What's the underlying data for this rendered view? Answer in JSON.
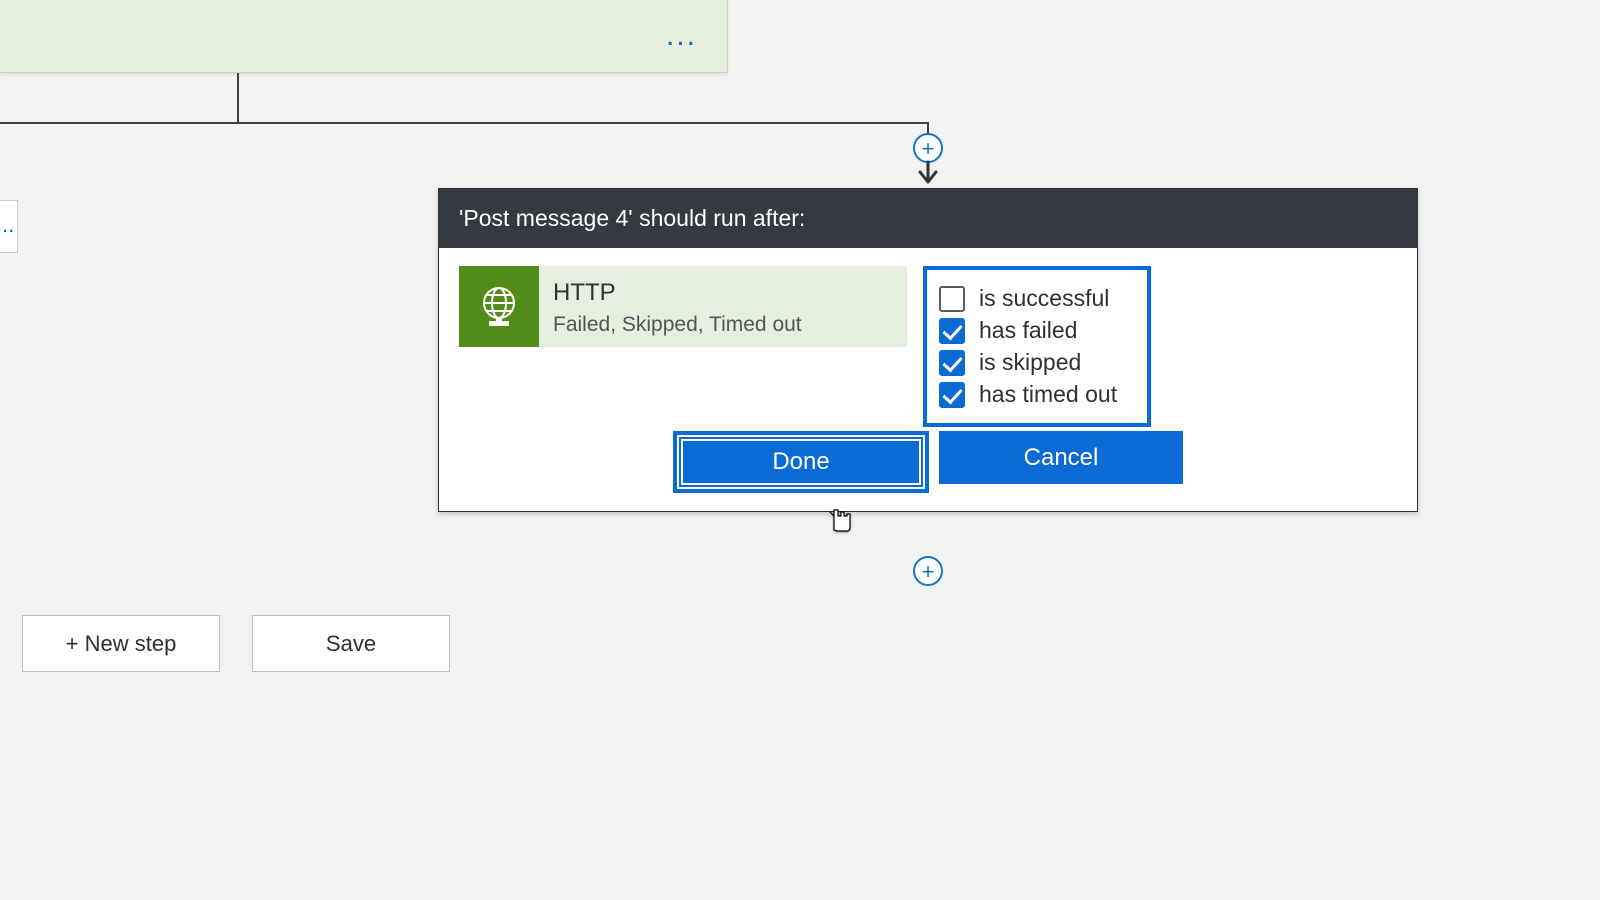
{
  "top_card": {
    "more_icon": "..."
  },
  "left_stub": {
    "frag": ".."
  },
  "panel": {
    "title": "'Post message 4' should run after:",
    "prev_action": {
      "name": "HTTP",
      "status_summary": "Failed, Skipped, Timed out"
    },
    "conditions": [
      {
        "label": "is successful",
        "checked": false
      },
      {
        "label": "has failed",
        "checked": true
      },
      {
        "label": "is skipped",
        "checked": true
      },
      {
        "label": "has timed out",
        "checked": true
      }
    ],
    "buttons": {
      "done": "Done",
      "cancel": "Cancel"
    }
  },
  "bottom": {
    "new_step": "+ New step",
    "save": "Save"
  }
}
